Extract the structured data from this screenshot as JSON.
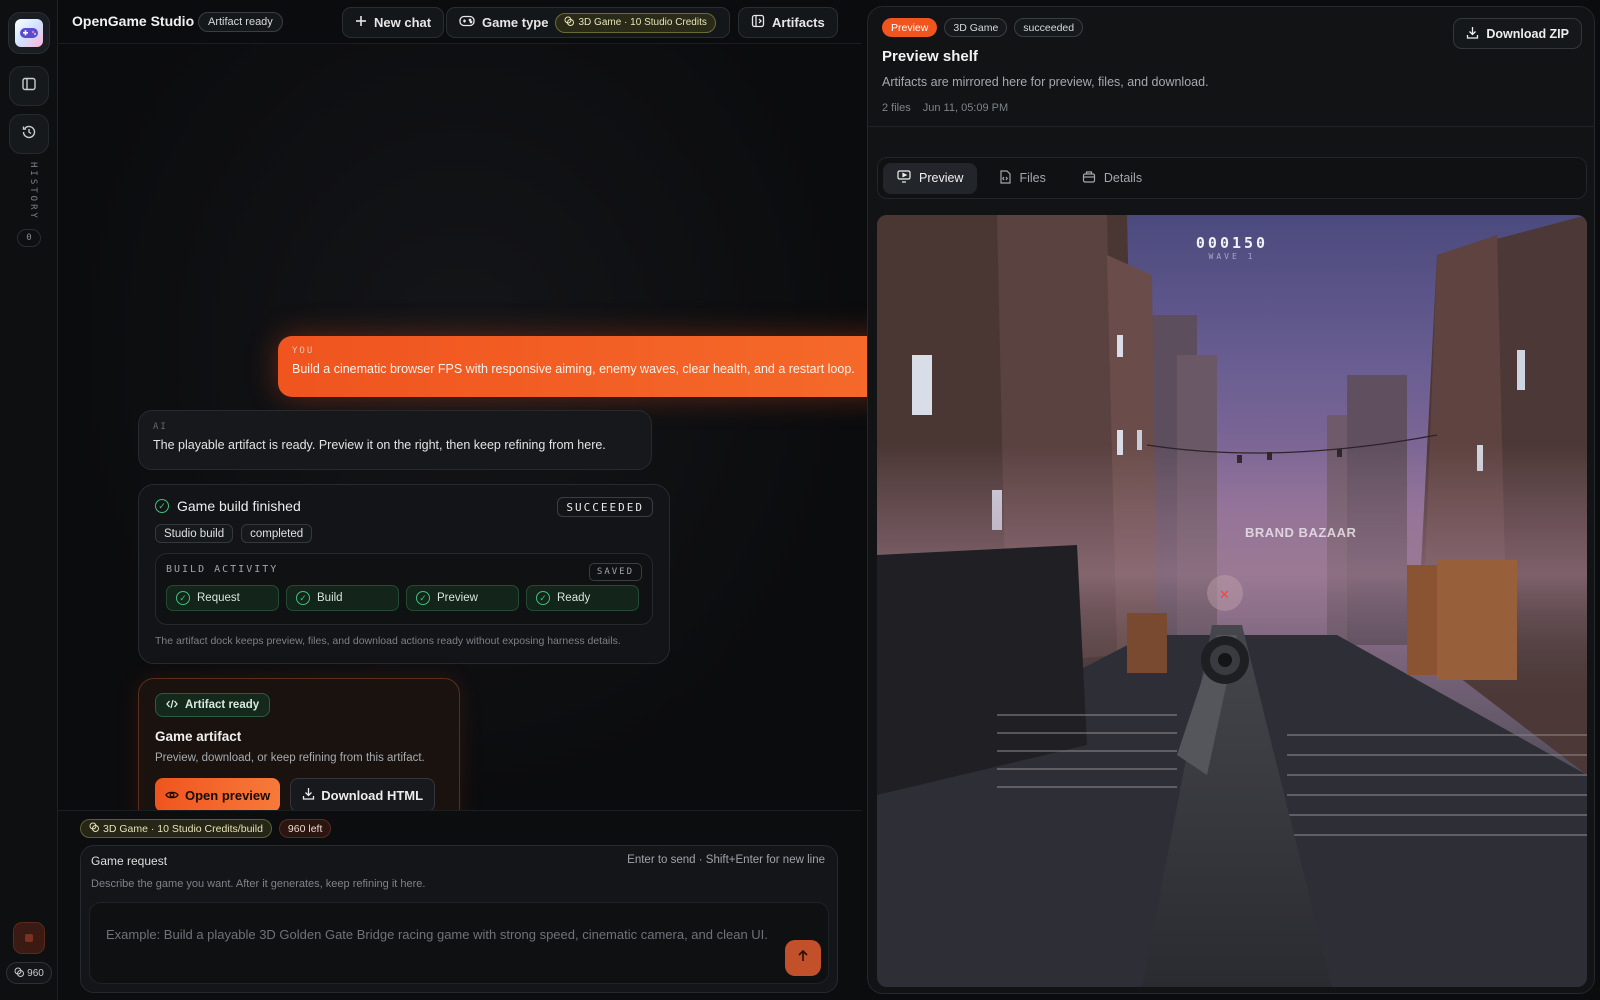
{
  "app": {
    "title": "OpenGame Studio",
    "status": "Artifact ready"
  },
  "rail": {
    "history_label": "HISTORY",
    "history_count": "0",
    "credits": "960"
  },
  "toolbar": {
    "new_chat": "New chat",
    "game_type": "Game type",
    "game_type_chip": "3D Game · 10 Studio Credits",
    "artifacts": "Artifacts"
  },
  "chat": {
    "user": {
      "role": "YOU",
      "text": "Build a cinematic browser FPS with responsive aiming, enemy waves, clear health, and a restart loop."
    },
    "ai": {
      "role": "AI",
      "text": "The playable artifact is ready. Preview it on the right, then keep refining from here."
    },
    "build": {
      "title": "Game build finished",
      "status": "SUCCEEDED",
      "tags": [
        "Studio build",
        "completed"
      ],
      "activity_label": "BUILD ACTIVITY",
      "saved_label": "SAVED",
      "steps": [
        "Request",
        "Build",
        "Preview",
        "Ready"
      ],
      "footnote": "The artifact dock keeps preview, files, and download actions ready without exposing harness details."
    },
    "artifact": {
      "badge": "Artifact ready",
      "title": "Game artifact",
      "subtitle": "Preview, download, or keep refining from this artifact.",
      "open_preview": "Open preview",
      "download_html": "Download HTML"
    }
  },
  "composer": {
    "credit_chip": "3D Game · 10 Studio Credits/build",
    "remaining": "960 left",
    "title": "Game request",
    "hint": "Enter to send · Shift+Enter for new line",
    "subtitle": "Describe the game you want. After it generates, keep refining it here.",
    "placeholder": "Example: Build a playable 3D Golden Gate Bridge racing game with strong speed, cinematic camera, and clean UI."
  },
  "preview_panel": {
    "badges": [
      "Preview",
      "3D Game",
      "succeeded"
    ],
    "download_zip": "Download ZIP",
    "title": "Preview shelf",
    "subtitle": "Artifacts are mirrored here for preview, files, and download.",
    "file_count": "2 files",
    "timestamp": "Jun 11, 05:09 PM",
    "tabs": [
      "Preview",
      "Files",
      "Details"
    ],
    "active_tab": "Preview"
  },
  "game": {
    "score": "000150",
    "wave": "WAVE 1",
    "sign": "BRAND BAZAAR"
  },
  "colors": {
    "accent": "#f0541f",
    "success": "#3fbf7a",
    "background": "#0b0c0e",
    "panel": "#111315"
  }
}
